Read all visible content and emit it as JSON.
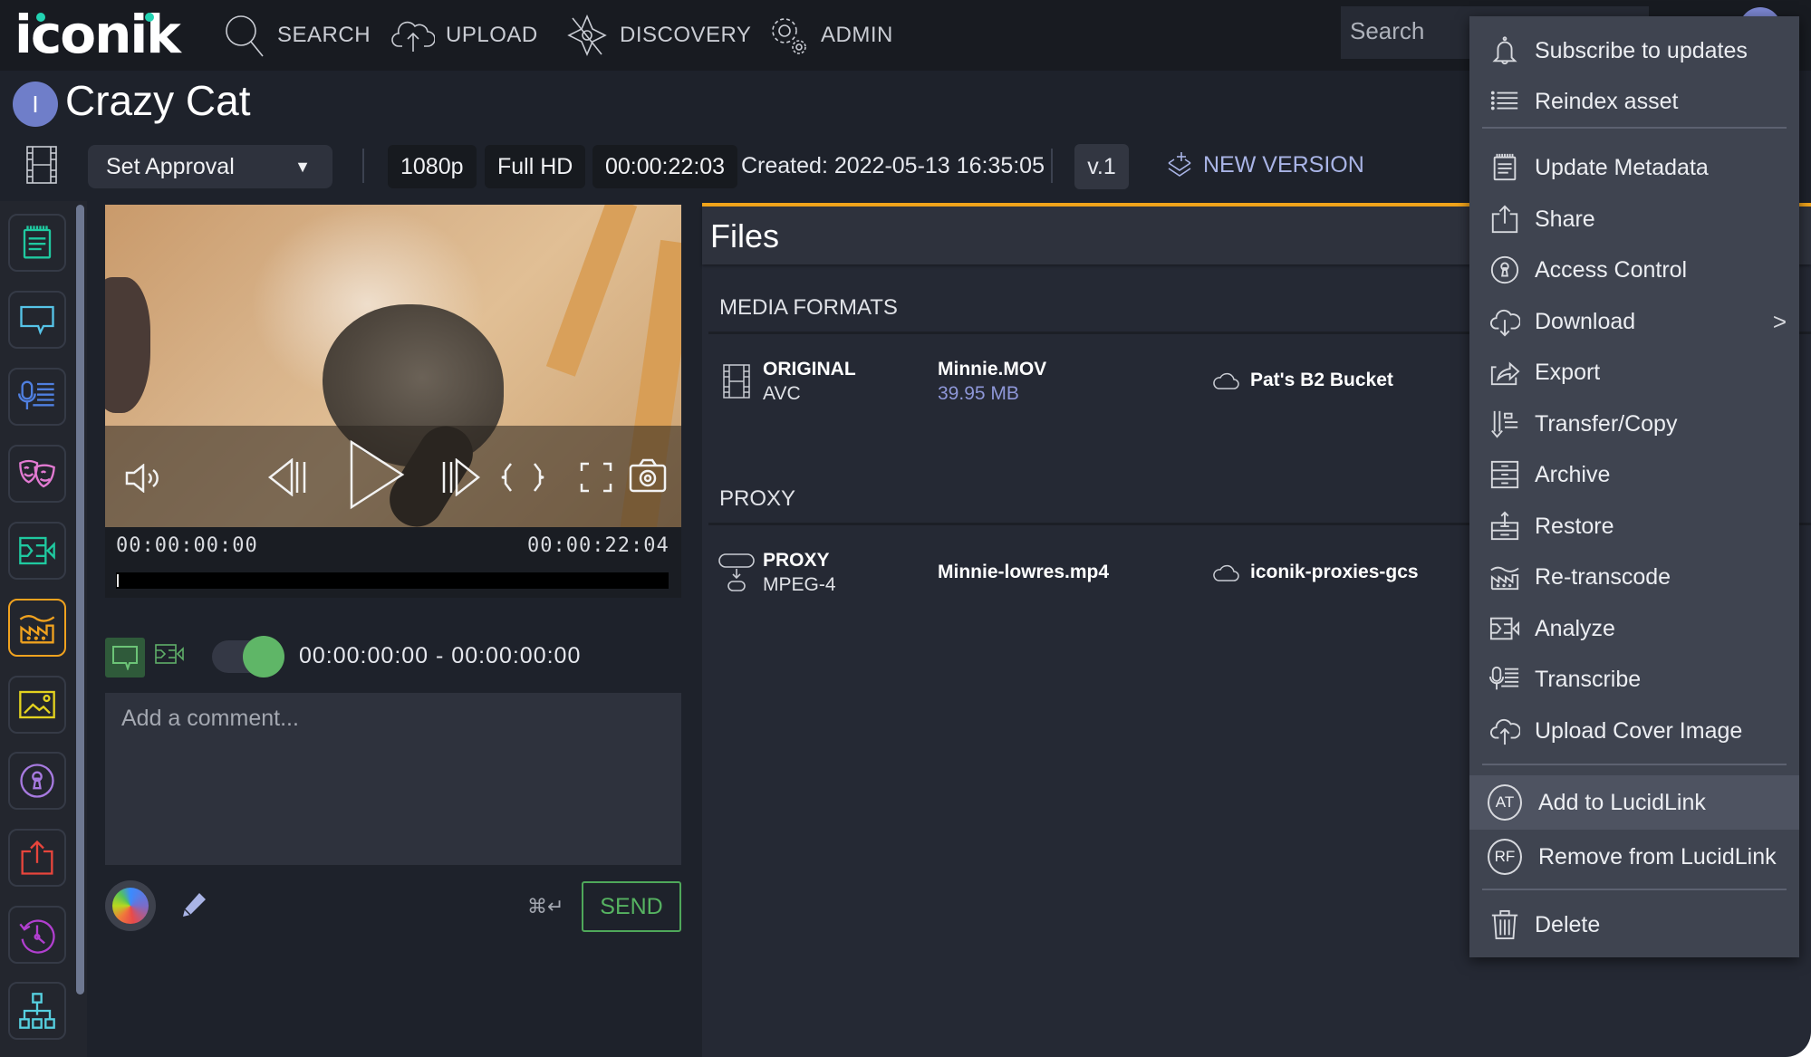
{
  "nav": {
    "logo": "iconik",
    "items": [
      {
        "label": "SEARCH",
        "icon": "search-icon"
      },
      {
        "label": "UPLOAD",
        "icon": "cloud-upload-icon"
      },
      {
        "label": "DISCOVERY",
        "icon": "compass-icon"
      },
      {
        "label": "ADMIN",
        "icon": "gear-icon"
      }
    ],
    "search_placeholder": "Search"
  },
  "asset": {
    "avatar_initial": "I",
    "title": "Crazy Cat"
  },
  "toolbar": {
    "approval_label": "Set Approval",
    "resolution": "1080p",
    "quality": "Full HD",
    "duration": "00:00:22:03",
    "created": "Created: 2022-05-13 16:35:05",
    "version": "v.1",
    "new_version_label": "NEW VERSION"
  },
  "sidebar": {
    "items": [
      {
        "name": "metadata",
        "icon": "notepad-icon",
        "color": "#1fc9a0",
        "active": false
      },
      {
        "name": "comments",
        "icon": "speech-bubble-icon",
        "color": "#56c4e8",
        "active": false
      },
      {
        "name": "transcription",
        "icon": "microphone-lines-icon",
        "color": "#4f7fe0",
        "active": false
      },
      {
        "name": "faces",
        "icon": "theater-masks-icon",
        "color": "#e27ad2",
        "active": false
      },
      {
        "name": "analyze",
        "icon": "video-circuit-icon",
        "color": "#1fc9a0",
        "active": false
      },
      {
        "name": "files",
        "icon": "factory-icon",
        "color": "#f0a21f",
        "active": true
      },
      {
        "name": "image",
        "icon": "picture-icon",
        "color": "#e3d21f",
        "active": false
      },
      {
        "name": "access",
        "icon": "keyhole-icon",
        "color": "#a77ae0",
        "active": false
      },
      {
        "name": "share",
        "icon": "share-icon",
        "color": "#e8453c",
        "active": false
      },
      {
        "name": "history",
        "icon": "history-clock-icon",
        "color": "#b13fcf",
        "active": false
      },
      {
        "name": "relations",
        "icon": "hierarchy-icon",
        "color": "#56d0e0",
        "active": false
      }
    ]
  },
  "player": {
    "timecode_start": "00:00:00:00",
    "timecode_end": "00:00:22:04",
    "progress": 0
  },
  "comment": {
    "range": "00:00:00:00 - 00:00:00:00",
    "placeholder": "Add a comment...",
    "shortcut": "⌘↵",
    "send_label": "SEND",
    "range_toggle_on": true
  },
  "files": {
    "title": "Files",
    "sections": [
      {
        "title": "MEDIA FORMATS",
        "rows": [
          {
            "icon": "film-strip-icon",
            "format": "ORIGINAL",
            "codec": "AVC",
            "filename": "Minnie.MOV",
            "size": "39.95 MB",
            "storage": "Pat's B2 Bucket"
          }
        ]
      },
      {
        "title": "PROXY",
        "rows": [
          {
            "icon": "proxy-icon",
            "format": "PROXY",
            "codec": "MPEG-4",
            "filename": "Minnie-lowres.mp4",
            "size": "",
            "storage": "iconik-proxies-gcs"
          }
        ]
      }
    ]
  },
  "menu": {
    "items": [
      {
        "label": "Subscribe to updates",
        "icon": "bell-icon"
      },
      {
        "label": "Reindex asset",
        "icon": "list-icon"
      },
      {
        "label": "Update Metadata",
        "icon": "notepad-icon"
      },
      {
        "label": "Share",
        "icon": "share-icon"
      },
      {
        "label": "Access Control",
        "icon": "keyhole-icon"
      },
      {
        "label": "Download",
        "icon": "cloud-download-icon",
        "submenu": true
      },
      {
        "label": "Export",
        "icon": "export-icon"
      },
      {
        "label": "Transfer/Copy",
        "icon": "transfer-icon"
      },
      {
        "label": "Archive",
        "icon": "archive-icon"
      },
      {
        "label": "Restore",
        "icon": "restore-icon"
      },
      {
        "label": "Re-transcode",
        "icon": "factory-icon"
      },
      {
        "label": "Analyze",
        "icon": "video-circuit-icon"
      },
      {
        "label": "Transcribe",
        "icon": "microphone-lines-icon"
      },
      {
        "label": "Upload Cover Image",
        "icon": "cloud-upload-icon"
      },
      {
        "label": "Add to LucidLink",
        "badge": "AT",
        "highlighted": true
      },
      {
        "label": "Remove from LucidLink",
        "badge": "RF"
      },
      {
        "label": "Delete",
        "icon": "trash-icon"
      }
    ],
    "submenu_chevron": ">"
  }
}
